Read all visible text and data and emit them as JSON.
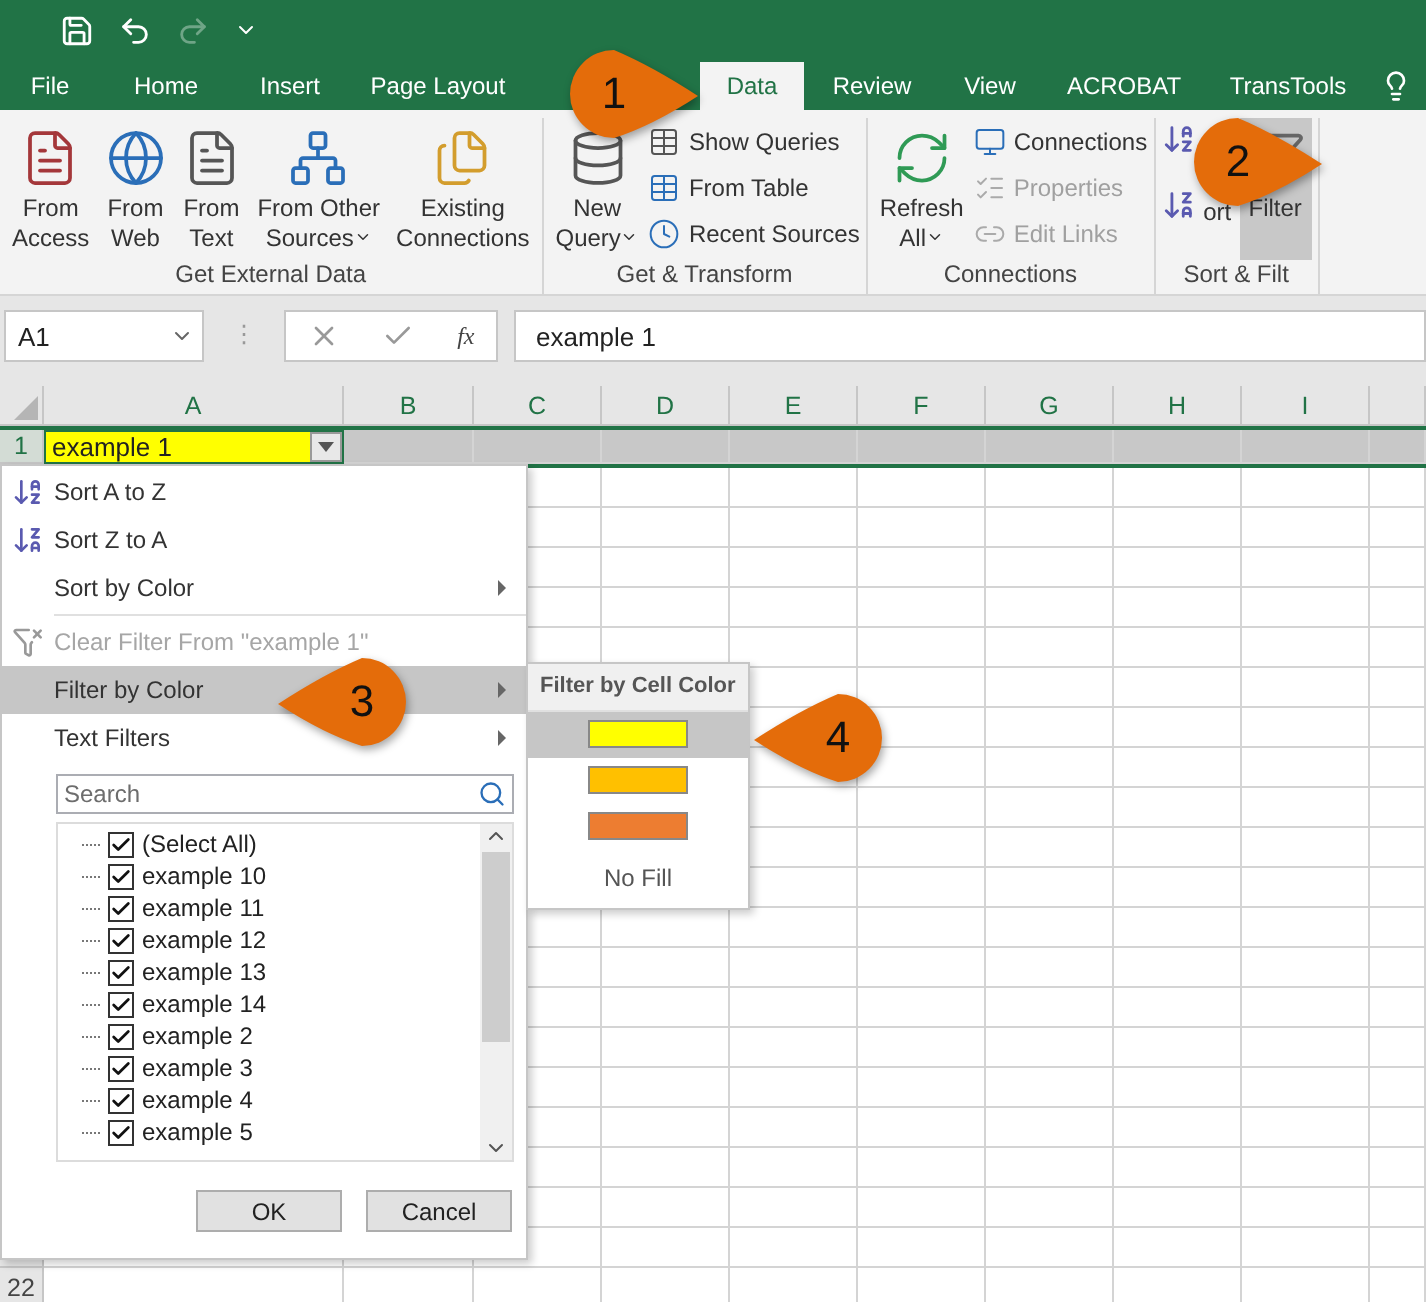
{
  "tabs": [
    {
      "label": "File",
      "selected": false
    },
    {
      "label": "Home",
      "selected": false
    },
    {
      "label": "Insert",
      "selected": false
    },
    {
      "label": "Page Layout",
      "selected": false
    },
    {
      "label": "Data",
      "selected": true
    },
    {
      "label": "Review",
      "selected": false
    },
    {
      "label": "View",
      "selected": false
    },
    {
      "label": "ACROBAT",
      "selected": false
    },
    {
      "label": "TransTools",
      "selected": false
    }
  ],
  "ribbon": {
    "groups": [
      {
        "label": "Get External Data",
        "buttons": [
          {
            "kind": "large",
            "lines": [
              "From",
              "Access"
            ],
            "dropdown": false,
            "selected": false
          },
          {
            "kind": "large",
            "lines": [
              "From",
              "Web"
            ],
            "dropdown": false,
            "selected": false
          },
          {
            "kind": "large",
            "lines": [
              "From",
              "Text"
            ],
            "dropdown": false,
            "selected": false
          },
          {
            "kind": "large",
            "lines": [
              "From Other",
              "Sources"
            ],
            "dropdown": true,
            "selected": false
          },
          {
            "kind": "large",
            "lines": [
              "Existing",
              "Connections"
            ],
            "dropdown": false,
            "selected": false
          }
        ]
      },
      {
        "label": "Get & Transform",
        "buttons": [
          {
            "kind": "large",
            "lines": [
              "New",
              "Query"
            ],
            "dropdown": true,
            "selected": false
          },
          {
            "kind": "stack",
            "items": [
              {
                "label": "Show Queries",
                "disabled": false
              },
              {
                "label": "From Table",
                "disabled": false
              },
              {
                "label": "Recent Sources",
                "disabled": false
              }
            ]
          }
        ]
      },
      {
        "label": "Connections",
        "buttons": [
          {
            "kind": "large",
            "lines": [
              "Refresh",
              "All"
            ],
            "dropdown": true,
            "selected": false
          },
          {
            "kind": "stack",
            "items": [
              {
                "label": "Connections",
                "disabled": false
              },
              {
                "label": "Properties",
                "disabled": true
              },
              {
                "label": "Edit Links",
                "disabled": true
              }
            ]
          }
        ]
      },
      {
        "label": "Sort & Filt",
        "buttons": [
          {
            "kind": "sortpair"
          },
          {
            "kind": "textonly",
            "lines": [
              "ort"
            ],
            "dropdown": false,
            "selected": false
          },
          {
            "kind": "large",
            "lines": [
              "Filter"
            ],
            "dropdown": false,
            "selected": true
          }
        ]
      }
    ]
  },
  "formula_bar": {
    "name_box": "A1",
    "separator": "⋮",
    "fx": "fx",
    "formula": "example 1"
  },
  "sheet": {
    "columns": [
      "A",
      "B",
      "C",
      "D",
      "E",
      "F",
      "G",
      "H",
      "I"
    ],
    "row_headers": [
      "1",
      "22"
    ],
    "cell_a1": {
      "text": "example 1",
      "color": "#ffff00"
    }
  },
  "filter_menu": {
    "items": [
      {
        "kind": "sort-az",
        "label": "Sort A to Z",
        "submenu": false,
        "disabled": false,
        "selected": false
      },
      {
        "kind": "sort-za",
        "label": "Sort Z to A",
        "submenu": false,
        "disabled": false,
        "selected": false
      },
      {
        "kind": "plain",
        "label": "Sort by Color",
        "submenu": true,
        "disabled": false,
        "selected": false
      },
      {
        "kind": "separator"
      },
      {
        "kind": "clear",
        "label": "Clear Filter From \"example 1\"",
        "submenu": false,
        "disabled": true,
        "selected": false
      },
      {
        "kind": "plain",
        "label": "Filter by Color",
        "submenu": true,
        "disabled": false,
        "selected": true
      },
      {
        "kind": "plain",
        "label": "Text Filters",
        "submenu": true,
        "disabled": false,
        "selected": false
      }
    ],
    "search": {
      "placeholder": "Search"
    },
    "values": [
      {
        "label": "(Select All)",
        "checked": true
      },
      {
        "label": "example 10",
        "checked": true
      },
      {
        "label": "example 11",
        "checked": true
      },
      {
        "label": "example 12",
        "checked": true
      },
      {
        "label": "example 13",
        "checked": true
      },
      {
        "label": "example 14",
        "checked": true
      },
      {
        "label": "example 2",
        "checked": true
      },
      {
        "label": "example 3",
        "checked": true
      },
      {
        "label": "example 4",
        "checked": true
      },
      {
        "label": "example 5",
        "checked": true
      }
    ],
    "buttons": [
      "OK",
      "Cancel"
    ]
  },
  "color_submenu": {
    "title": "Filter by Cell Color",
    "swatches": [
      {
        "color": "#ffff00",
        "selected": true
      },
      {
        "color": "#ffc000",
        "selected": false
      },
      {
        "color": "#ed7d31",
        "selected": false
      }
    ],
    "no_fill": "No Fill"
  },
  "callouts": [
    "1",
    "2",
    "3",
    "4"
  ]
}
